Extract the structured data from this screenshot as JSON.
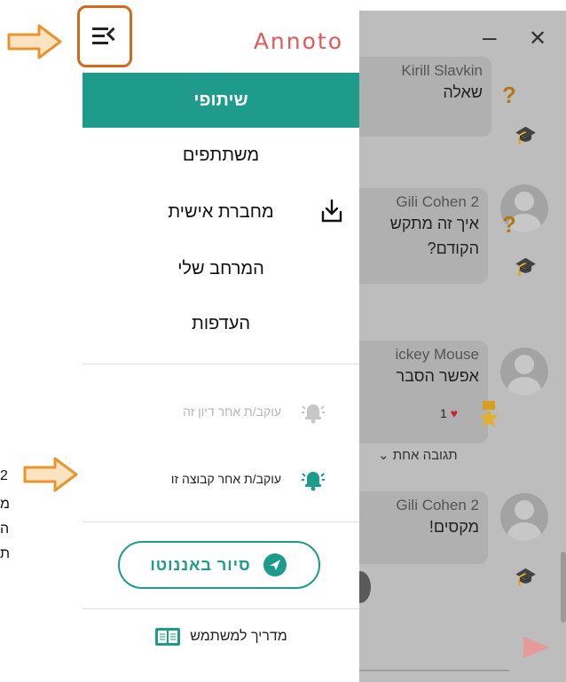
{
  "chat": {
    "minimize_label": "–",
    "close_label": "✕",
    "messages": [
      {
        "author": "Kirill Slavkin",
        "text": "שאלה"
      },
      {
        "author": "2 Gili Cohen",
        "text_line1": "איך זה מתקש",
        "text_line2": "הקודם?"
      },
      {
        "author": "ickey Mouse",
        "text": "אפשר הסבר",
        "likes": "1"
      },
      {
        "author": "2 Gili Cohen",
        "text": "מקסים!"
      }
    ],
    "reply_count": "תגובה אחת",
    "question_mark": "?"
  },
  "drawer": {
    "logo": "Annoto",
    "menu_items": [
      {
        "label": "שיתופי",
        "active": true
      },
      {
        "label": "משתתפים",
        "active": false
      },
      {
        "label": "מחברת אישית",
        "active": false
      },
      {
        "label": "המרחב שלי",
        "active": false
      },
      {
        "label": "העדפות",
        "active": false
      }
    ],
    "follow_discussion": "עוקב/ת אחר דיון זה",
    "follow_group": "עוקב/ת אחר קבוצה זו",
    "tour_button": "סיור באננוטו",
    "user_guide": "מדריך למשתמש"
  },
  "side_annotation": {
    "line1": "2",
    "line2": "מ",
    "line3": "ה",
    "line4": "ת"
  },
  "colors": {
    "accent": "#1e9b8a",
    "logo": "#e05a5a",
    "highlight_border": "#d06a1e",
    "arrow_fill": "#fbe3c2",
    "arrow_stroke": "#e8942e"
  },
  "icons": [
    "menu-collapse-icon",
    "download-icon",
    "bell-icon",
    "tour-compass-icon",
    "book-icon",
    "graduation-cap-icon",
    "heart-icon",
    "star-badge-icon",
    "send-icon"
  ]
}
